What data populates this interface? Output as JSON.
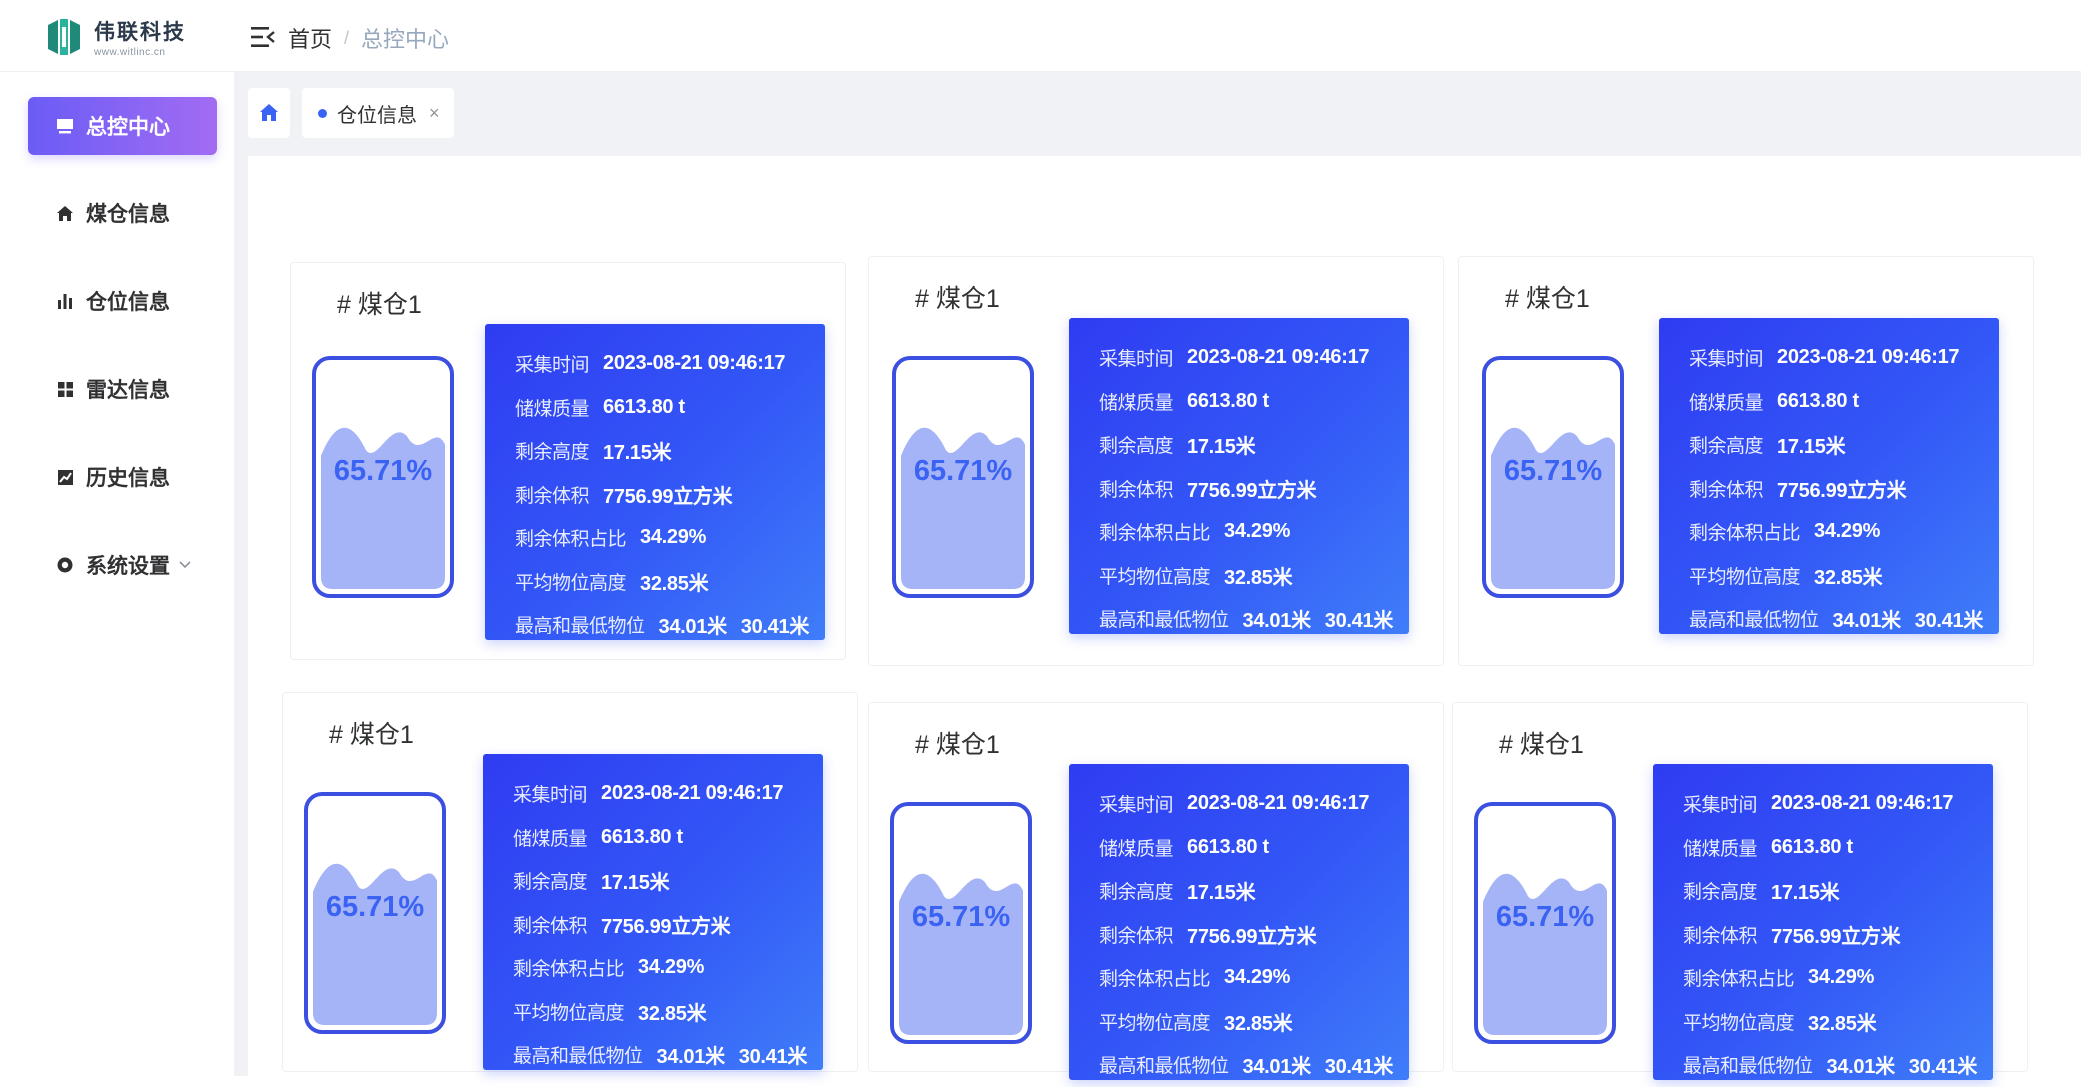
{
  "header": {
    "logo_name": "伟联科技",
    "logo_url": "www.witlinc.cn",
    "breadcrumb": {
      "home": "首页",
      "separator": "/",
      "current": "总控中心"
    }
  },
  "sidebar": {
    "items": [
      {
        "label": "总控中心",
        "icon": "monitor-icon",
        "active": true
      },
      {
        "label": "煤仓信息",
        "icon": "home-icon",
        "active": false
      },
      {
        "label": "仓位信息",
        "icon": "bar-chart-icon",
        "active": false
      },
      {
        "label": "雷达信息",
        "icon": "grid-icon",
        "active": false
      },
      {
        "label": "历史信息",
        "icon": "line-chart-icon",
        "active": false
      },
      {
        "label": "系统设置",
        "icon": "settings-icon",
        "active": false,
        "has_submenu": true
      }
    ]
  },
  "tabs": {
    "home_icon": "home-icon",
    "page_tab": "仓位信息",
    "close": "×"
  },
  "labels": {
    "time": "采集时间",
    "mass": "储煤质量",
    "remain_height": "剩余高度",
    "remain_volume": "剩余体积",
    "remain_ratio": "剩余体积占比",
    "avg_height": "平均物位高度",
    "max_min": "最高和最低物位"
  },
  "cards": [
    {
      "title": "# 煤仓1",
      "percent": "65.71%",
      "fill": 0.6571,
      "time": "2023-08-21 09:46:17",
      "mass": "6613.80 t",
      "remain_height": "17.15米",
      "remain_volume": "7756.99立方米",
      "remain_ratio": "34.29%",
      "avg_height": "32.85米",
      "max": "34.01米",
      "min": "30.41米"
    },
    {
      "title": "# 煤仓1",
      "percent": "65.71%",
      "fill": 0.6571,
      "time": "2023-08-21 09:46:17",
      "mass": "6613.80 t",
      "remain_height": "17.15米",
      "remain_volume": "7756.99立方米",
      "remain_ratio": "34.29%",
      "avg_height": "32.85米",
      "max": "34.01米",
      "min": "30.41米"
    },
    {
      "title": "# 煤仓1",
      "percent": "65.71%",
      "fill": 0.6571,
      "time": "2023-08-21 09:46:17",
      "mass": "6613.80 t",
      "remain_height": "17.15米",
      "remain_volume": "7756.99立方米",
      "remain_ratio": "34.29%",
      "avg_height": "32.85米",
      "max": "34.01米",
      "min": "30.41米"
    },
    {
      "title": "# 煤仓1",
      "percent": "65.71%",
      "fill": 0.6571,
      "time": "2023-08-21 09:46:17",
      "mass": "6613.80 t",
      "remain_height": "17.15米",
      "remain_volume": "7756.99立方米",
      "remain_ratio": "34.29%",
      "avg_height": "32.85米",
      "max": "34.01米",
      "min": "30.41米"
    },
    {
      "title": "# 煤仓1",
      "percent": "65.71%",
      "fill": 0.6571,
      "time": "2023-08-21 09:46:17",
      "mass": "6613.80 t",
      "remain_height": "17.15米",
      "remain_volume": "7756.99立方米",
      "remain_ratio": "34.29%",
      "avg_height": "32.85米",
      "max": "34.01米",
      "min": "30.41米"
    },
    {
      "title": "# 煤仓1",
      "percent": "65.71%",
      "fill": 0.6571,
      "time": "2023-08-21 09:46:17",
      "mass": "6613.80 t",
      "remain_height": "17.15米",
      "remain_volume": "7756.99立方米",
      "remain_ratio": "34.29%",
      "avg_height": "32.85米",
      "max": "34.01米",
      "min": "30.41米"
    }
  ],
  "colors": {
    "accent": "#3358f7",
    "menu_active_start": "#6b5cf6",
    "menu_active_end": "#a26cf2",
    "tank_border": "#3b4fe0",
    "tank_fill": "#a5b3f7"
  }
}
